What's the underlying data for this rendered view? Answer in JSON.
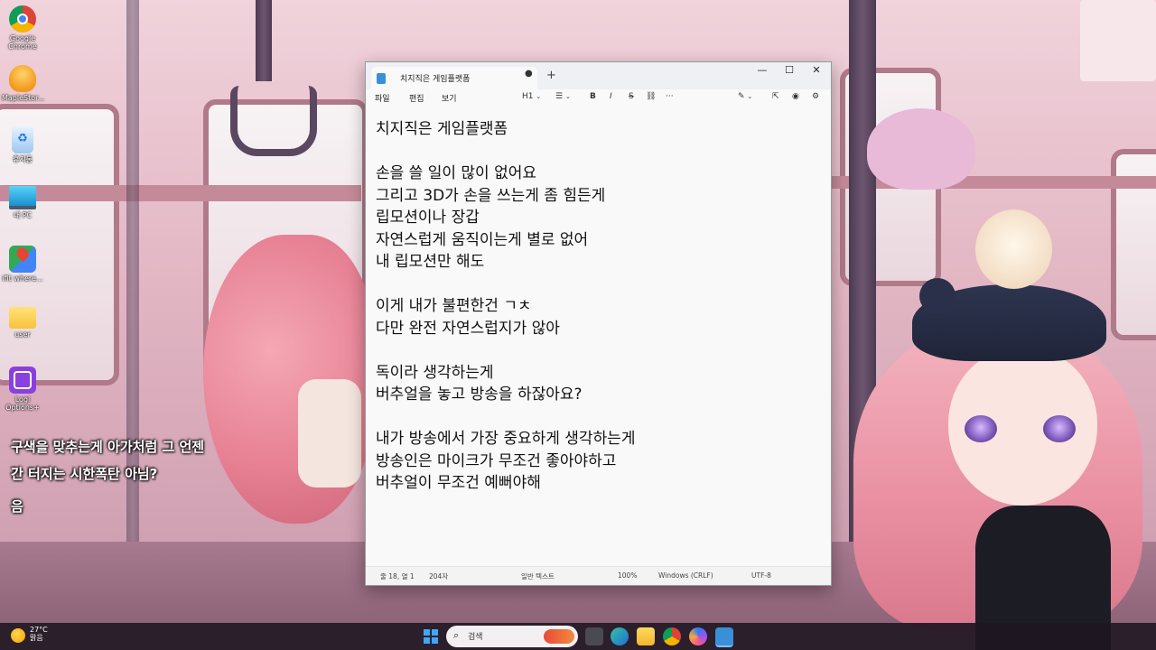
{
  "desktop": {
    "icons": [
      {
        "label": "Google\nChrome",
        "icon": "chrome-icon"
      },
      {
        "label": "MapleStor...",
        "icon": "maplestory-icon"
      },
      {
        "label": "휴지통",
        "icon": "recycle-bin-icon"
      },
      {
        "label": "내 PC",
        "icon": "this-pc-icon"
      },
      {
        "label": "ifit where...",
        "icon": "maps-icon"
      },
      {
        "label": "user",
        "icon": "folder-icon"
      },
      {
        "label": "Logi\nOptions+",
        "icon": "logi-options-icon"
      }
    ]
  },
  "overlay": {
    "lines": [
      "구색을 맞추는게 아가처럼 그 언젠",
      "간 터지는 시한폭탄 아님?",
      "음"
    ]
  },
  "notepad": {
    "tab_title": "치지직은 게임플랫폼",
    "tab_modified_indicator": "●",
    "new_tab": "+",
    "window_controls": {
      "minimize": "—",
      "maximize": "☐",
      "close": "✕"
    },
    "menu": {
      "file": "파일",
      "edit": "편집",
      "view": "보기"
    },
    "toolbar": {
      "heading": "H1",
      "list": "☰",
      "bold": "B",
      "italic": "I",
      "strike": "S",
      "link": "⛓",
      "more": "···"
    },
    "content": [
      "치지직은 게임플랫폼",
      "",
      "손을 쓸 일이 많이 없어요",
      "그리고 3D가 손을 쓰는게 좀 힘든게",
      "립모션이나 장갑",
      "자연스럽게 움직이는게 별로 없어",
      "내 립모션만 해도",
      "",
      "이게 내가 불편한건 ㄱㅊ",
      "다만 완전 자연스럽지가 않아",
      "",
      "독이라 생각하는게",
      "버추얼을 놓고 방송을 하잖아요?",
      "",
      "내가 방송에서 가장 중요하게 생각하는게",
      "방송인은 마이크가 무조건 좋아야하고",
      "버추얼이 무조건 예뻐야해"
    ],
    "status": {
      "position": "줄 18, 열 1",
      "chars": "204자",
      "format": "일반 텍스트",
      "zoom": "100%",
      "line_ending": "Windows (CRLF)",
      "encoding": "UTF-8"
    }
  },
  "taskbar": {
    "weather_temp": "27°C",
    "weather_desc": "맑음",
    "search_placeholder": "검색",
    "apps": [
      "start-icon",
      "search-icon",
      "task-view-icon",
      "edge-icon",
      "file-explorer-icon",
      "chrome-icon",
      "copilot-icon",
      "notepad-icon"
    ]
  }
}
